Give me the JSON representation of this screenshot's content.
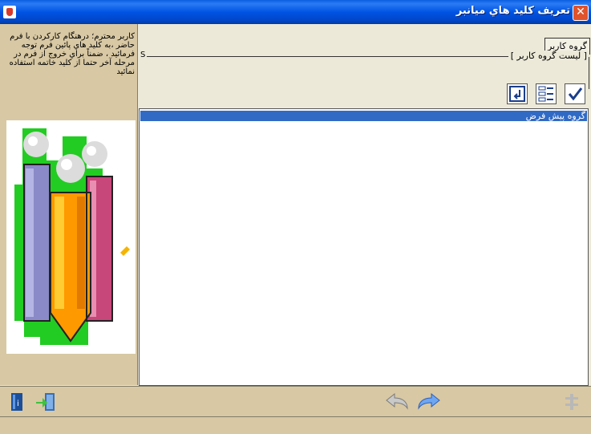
{
  "window": {
    "title": "تعريف کليد هاي ميانبر",
    "close_glyph": "✕"
  },
  "help": {
    "text": "کاربر محترم؛ درهنگام کارکردن با فرم حاضر ،به کليد هاي پائين فرم توجه فرمائيد ، ضمناً براي خروج از فرم در مرحله آخر حتما از کليد خاتمه استفاده نمائيد"
  },
  "tabs": {
    "user_group": "گروه کاربر"
  },
  "group_frame": {
    "label": "[ ليست گروه کاربر ]",
    "left_marker": "S"
  },
  "list": {
    "items": [
      "گروه پيش فرض"
    ],
    "selected_index": 0
  },
  "colors": {
    "title_bar": "#0054e3",
    "panel": "#d8c8a3",
    "selection": "#316ac5"
  },
  "icons": {
    "toolbar": [
      "check-icon",
      "list-icon",
      "return-icon"
    ],
    "bottom_left": [
      "help-book-icon",
      "exit-door-icon"
    ],
    "bottom_center": [
      "undo-icon",
      "redo-icon"
    ],
    "bottom_right": [
      "tree-icon"
    ]
  }
}
